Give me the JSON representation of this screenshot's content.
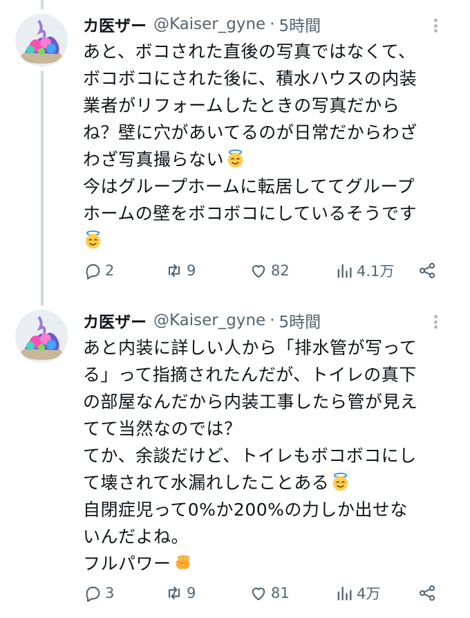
{
  "tweets": [
    {
      "author": {
        "display_name": "カ医ザー",
        "handle": "@Kaiser_gyne"
      },
      "separator": "·",
      "time": "5時間",
      "lines": [
        "あと、ボコされた直後の写真ではなくて、",
        "ボコボコにされた後に、積水ハウスの内装",
        "業者がリフォームしたときの写真だから",
        "ね？壁に穴があいてるのが日常だからわざ",
        "わざ写真撮らない",
        "今はグループホームに転居しててグループ",
        "ホームの壁をボコボコにしているそうです",
        ""
      ],
      "emoji": [
        "smiling-face-with-halo",
        "smiling-face-with-halo"
      ],
      "stats": {
        "replies": "2",
        "retweets": "9",
        "likes": "82",
        "views": "4.1万"
      }
    },
    {
      "author": {
        "display_name": "カ医ザー",
        "handle": "@Kaiser_gyne"
      },
      "separator": "·",
      "time": "5時間",
      "lines": [
        "あと内装に詳しい人から「排水管が写って",
        "る」って指摘されたんだが、トイレの真下",
        "の部屋なんだから内装工事したら管が見え",
        "てて当然なのでは？",
        "てか、余談だけど、トイレもボコボコにし",
        "て壊されて水漏れしたことある",
        "自閉症児って0%か200%の力しか出せな",
        "いんだよね。",
        "フルパワー"
      ],
      "emoji": [
        "smiling-face-with-halo",
        "oncoming-fist"
      ],
      "stats": {
        "replies": "3",
        "retweets": "9",
        "likes": "81",
        "views": "4万"
      }
    }
  ],
  "icons": {
    "reply": "speech-bubble-icon",
    "retweet": "retweet-arrows-icon",
    "like": "heart-icon",
    "views": "bar-chart-icon",
    "share": "share-nodes-icon",
    "more": "vertical-dots-icon"
  },
  "colors": {
    "text": "#0f1419",
    "secondary": "#536471",
    "thread_line": "#cfd9de",
    "background": "#ffffff"
  }
}
